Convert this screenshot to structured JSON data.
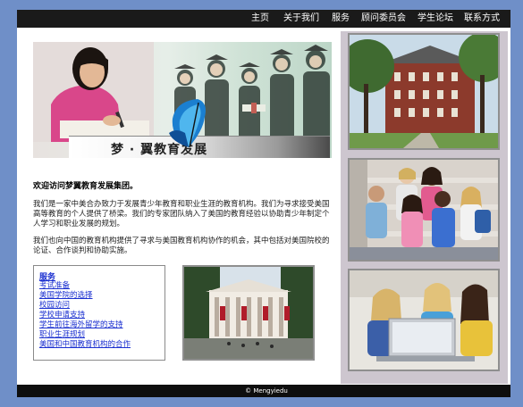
{
  "nav": {
    "items": [
      "主页",
      "关于我们",
      "服务",
      "顾问委员会",
      "学生论坛",
      "联系方式"
    ]
  },
  "banner": {
    "title": "梦 · 翼教育发展"
  },
  "content": {
    "welcome": "欢迎访问梦翼教育发展集团。",
    "para1": "我们是一家中美合办致力于发展青少年教育和职业生涯的教育机构。我们为寻求接受美国高等教育的个人提供了桥梁。我们的专家团队纳入了美国的教育经验以协助青少年制定个人学习和职业发展的规划。",
    "para2": "我们也向中国的教育机构提供了寻求与美国教育机构协作的机会，其中包括对美国院校的论证、合作谈判和协助实施。"
  },
  "services": {
    "heading": "服务",
    "links": [
      "考试准备",
      "美国学院的选择",
      "校园访问",
      "学校申请支持",
      "学生前往海外留学的支持",
      "职业生涯规划",
      "美国和中国教育机构的合作"
    ]
  },
  "footer": {
    "copyright": "© Mengyiedu"
  },
  "colors": {
    "page_bg": "#6f8fc8",
    "nav_bg": "#1a1a1a",
    "right_col_bg": "#cdc6cf",
    "link": "#1a2fd0"
  }
}
